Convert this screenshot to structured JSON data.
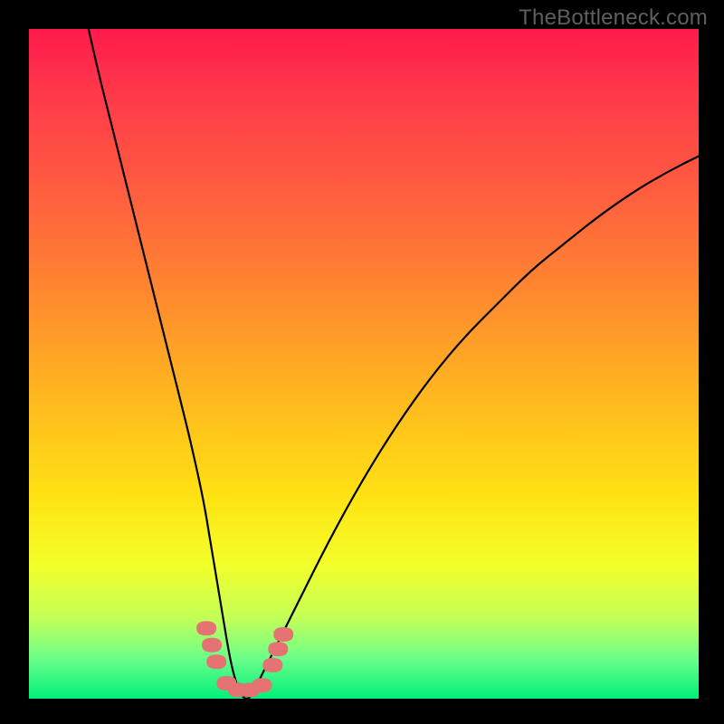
{
  "watermark": "TheBottleneck.com",
  "chart_data": {
    "type": "line",
    "title": "",
    "xlabel": "",
    "ylabel": "",
    "xlim": [
      0,
      100
    ],
    "ylim": [
      0,
      100
    ],
    "grid": false,
    "series": [
      {
        "name": "curve",
        "x": [
          8,
          10,
          12,
          14,
          16,
          18,
          20,
          22,
          24,
          26,
          27,
          28,
          29,
          30,
          31,
          32,
          33,
          34,
          36,
          40,
          45,
          50,
          55,
          60,
          65,
          70,
          75,
          80,
          85,
          90,
          95,
          100
        ],
        "values": [
          104,
          95,
          87,
          79,
          71,
          63,
          55,
          47,
          39,
          30,
          24,
          18,
          12,
          6,
          2,
          0,
          0,
          2,
          6,
          14,
          24,
          33,
          41,
          48,
          54,
          59,
          64,
          68,
          72,
          75.5,
          78.5,
          81
        ]
      }
    ],
    "markers": [
      {
        "name": "left-upper",
        "x": 26.5,
        "y_pct": 10.5
      },
      {
        "name": "left-mid",
        "x": 27.3,
        "y_pct": 8.0
      },
      {
        "name": "left-lower",
        "x": 28.0,
        "y_pct": 5.5
      },
      {
        "name": "bottom-1",
        "x": 29.5,
        "y_pct": 2.3
      },
      {
        "name": "bottom-2",
        "x": 31.2,
        "y_pct": 1.3
      },
      {
        "name": "bottom-3",
        "x": 33.0,
        "y_pct": 1.3
      },
      {
        "name": "bottom-4",
        "x": 34.8,
        "y_pct": 2.0
      },
      {
        "name": "right-lower",
        "x": 36.4,
        "y_pct": 5.0
      },
      {
        "name": "right-mid",
        "x": 37.2,
        "y_pct": 7.4
      },
      {
        "name": "right-upper",
        "x": 38.0,
        "y_pct": 9.6
      }
    ],
    "marker_color": "#e57373",
    "curve_color": "#000000"
  }
}
